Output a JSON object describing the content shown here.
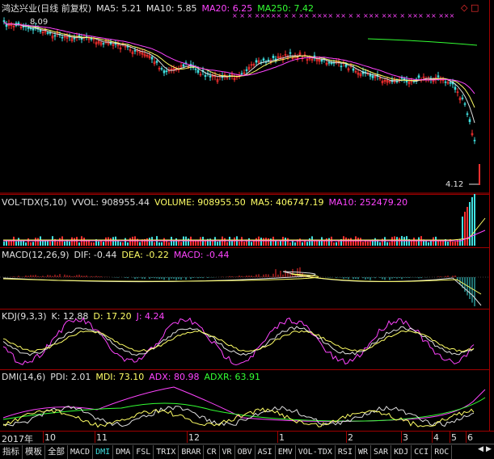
{
  "price_panel": {
    "title": "鸿达兴业(日线 前复权)",
    "ma5": "MA5: 5.21",
    "ma10": "MA10: 5.85",
    "ma20": "MA20: 6.25",
    "ma250": "MA250: 7.42",
    "high_label": "8.09",
    "low_label": "4.12",
    "top_right_icons": "◇ □",
    "markers": "× × × ××××× × × ×× ×××× ×× × × ××× ××× × ××× ×× ×××"
  },
  "vol_panel": {
    "name": "VOL-TDX(5,10)",
    "vvol": "VVOL: 908955.44",
    "volume": "VOLUME: 908955.50",
    "ma5": "MA5: 406747.19",
    "ma10": "MA10: 252479.20"
  },
  "macd_panel": {
    "name": "MACD(12,26,9)",
    "dif": "DIF: -0.44",
    "dea": "DEA: -0.22",
    "macd": "MACD: -0.44"
  },
  "kdj_panel": {
    "name": "KDJ(9,3,3)",
    "k": "K: 12.88",
    "d": "D: 17.20",
    "j": "J: 4.24"
  },
  "dmi_panel": {
    "name": "DMI(14,6)",
    "pdi": "PDI: 2.01",
    "mdi": "MDI: 73.10",
    "adx": "ADX: 80.98",
    "adxr": "ADXR: 63.91"
  },
  "date_axis": {
    "labels": [
      "2017年",
      "10",
      "11",
      "12",
      "1",
      "2",
      "3",
      "4",
      "5",
      "6"
    ]
  },
  "tabs": [
    {
      "label": "指标",
      "state": "normal"
    },
    {
      "label": "模板",
      "state": "normal"
    },
    {
      "label": "全部",
      "state": "normal"
    },
    {
      "label": "MACD",
      "state": "normal"
    },
    {
      "label": "DMI",
      "state": "current"
    },
    {
      "label": "DMA",
      "state": "normal"
    },
    {
      "label": "FSL",
      "state": "normal"
    },
    {
      "label": "TRIX",
      "state": "normal"
    },
    {
      "label": "BRAR",
      "state": "normal"
    },
    {
      "label": "CR",
      "state": "normal"
    },
    {
      "label": "VR",
      "state": "normal"
    },
    {
      "label": "OBV",
      "state": "normal"
    },
    {
      "label": "ASI",
      "state": "normal"
    },
    {
      "label": "EMV",
      "state": "normal"
    },
    {
      "label": "VOL-TDX",
      "state": "normal"
    },
    {
      "label": "RSI",
      "state": "normal"
    },
    {
      "label": "WR",
      "state": "normal"
    },
    {
      "label": "SAR",
      "state": "normal"
    },
    {
      "label": "KDJ",
      "state": "normal"
    },
    {
      "label": "CCI",
      "state": "normal"
    },
    {
      "label": "ROC",
      "state": "normal"
    }
  ],
  "colors": {
    "up": "#ff3030",
    "down": "#40e0e0",
    "grid": "#a00000",
    "ma5": "#e0e0e0",
    "ma10": "#ffff66",
    "ma20": "#ff44ff",
    "ma250": "#33ff33"
  }
}
